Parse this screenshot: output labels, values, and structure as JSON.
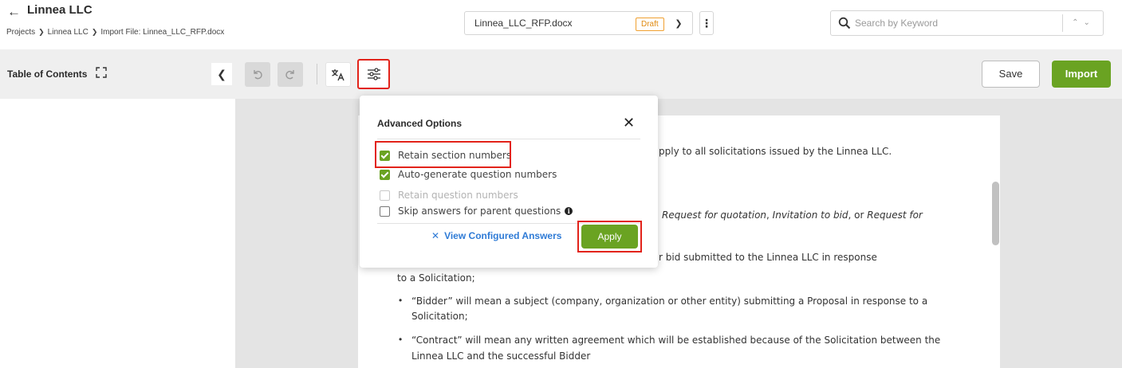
{
  "header": {
    "back_icon": "back-arrow-icon",
    "project_title": "Linnea LLC",
    "breadcrumb": [
      "Projects",
      "Linnea LLC",
      "Import File: Linnea_LLC_RFP.docx"
    ],
    "file_name": "Linnea_LLC_RFP.docx",
    "status_badge": "Draft",
    "search_placeholder": "Search by Keyword"
  },
  "toolbar": {
    "toc_label": "Table of Contents",
    "save_label": "Save",
    "import_label": "Import"
  },
  "popup": {
    "title": "Advanced Options",
    "options": [
      {
        "label": "Retain section numbers",
        "state": "checked"
      },
      {
        "label": "Auto-generate question numbers",
        "state": "checked"
      },
      {
        "label": "Retain question numbers",
        "state": "disabled"
      },
      {
        "label": "Skip answers for parent questions",
        "state": "unchecked"
      }
    ],
    "view_link": "View Configured Answers",
    "apply_label": "Apply"
  },
  "document": {
    "line1": "pply to all solicitations issued by the Linnea LLC.",
    "line2_part1": "Request for quotation",
    "line2_part2": ", ",
    "line2_part3": "Invitation to bid",
    "line2_part4": ", or ",
    "line2_part5": "Request for",
    "line3": "r bid submitted to the Linnea LLC in response",
    "line4": "to a Solicitation;",
    "bullet1_line1": "“Bidder” will mean a subject (company, organization or other entity) submitting a Proposal in response to a",
    "bullet1_line2": "Solicitation;",
    "bullet2_line1": "“Contract” will mean any written agreement which will be established because of the Solicitation between the",
    "bullet2_line2": "Linnea LLC and the successful Bidder"
  },
  "colors": {
    "accent_green": "#6aa322",
    "highlight_red": "#e2231a",
    "link_blue": "#2f7bd6",
    "draft_orange": "#e08a10"
  }
}
